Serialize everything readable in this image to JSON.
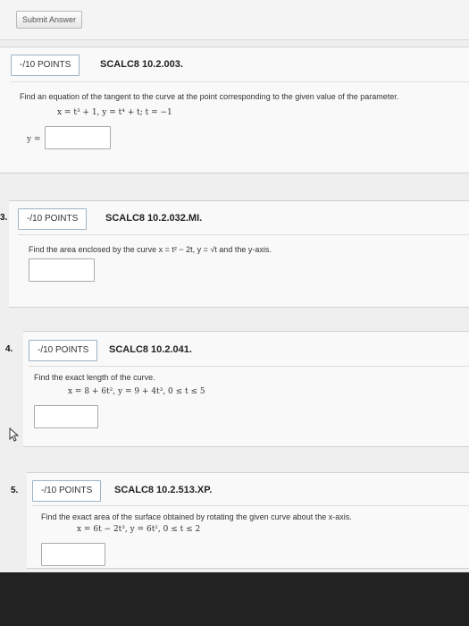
{
  "header": {
    "submit_label": "Submit Answer"
  },
  "questions": [
    {
      "number": "",
      "points": "-/10 POINTS",
      "code": "SCALC8 10.2.003.",
      "prompt": "Find an equation of the tangent to the curve at the point corresponding to the given value of the parameter.",
      "formula": "x = t³ + 1,   y = t⁴ + t;   t = −1",
      "answer_label": "y ="
    },
    {
      "number": "3.",
      "points": "-/10 POINTS",
      "code": "SCALC8 10.2.032.MI.",
      "prompt": "Find the area enclosed by the curve x = t² − 2t, y = √t and the y-axis.",
      "formula": "",
      "answer_label": ""
    },
    {
      "number": "4.",
      "points": "-/10 POINTS",
      "code": "SCALC8 10.2.041.",
      "prompt": "Find the exact length of the curve.",
      "formula": "x = 8 + 6t²,   y = 9 + 4t³,   0 ≤ t ≤ 5",
      "answer_label": ""
    },
    {
      "number": "5.",
      "points": "-/10 POINTS",
      "code": "SCALC8 10.2.513.XP.",
      "prompt": "Find the exact area of the surface obtained by rotating the given curve about the x-axis.",
      "formula": "x = 6t − 2t³,   y = 6t²,   0 ≤ t ≤ 2",
      "answer_label": ""
    }
  ],
  "icons": {
    "cursor": "mouse-pointer-icon"
  }
}
